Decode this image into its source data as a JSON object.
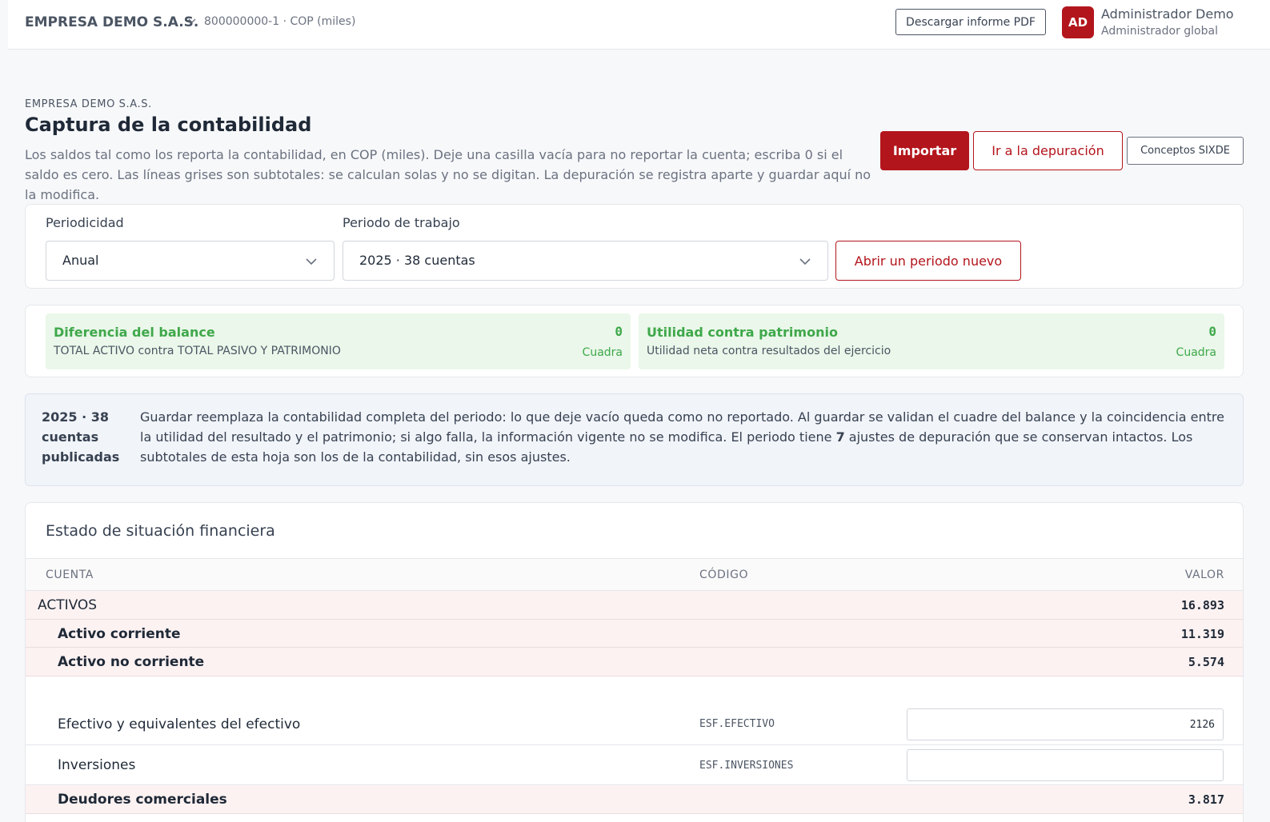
{
  "topbar": {
    "company": "EMPRESA DEMO S.A.S.",
    "nit": "800000000-1 · COP (miles)",
    "pdf_button": "Descargar informe PDF",
    "avatar": "AD",
    "user_name": "Administrador Demo",
    "user_role": "Administrador global"
  },
  "header": {
    "eyebrow": "EMPRESA DEMO S.A.S.",
    "title": "Captura de la contabilidad",
    "description": "Los saldos tal como los reporta la contabilidad, en COP (miles). Deje una casilla vacía para no reportar la cuenta; escriba 0 si el saldo es cero. Las líneas grises son subtotales: se calculan solas y no se digitan. La depuración se registra aparte y guardar aquí no la modifica.",
    "import_button": "Importar",
    "depuracion_button": "Ir a la depuración",
    "sixde_button": "Conceptos SIXDE"
  },
  "period": {
    "periodicity_label": "Periodicidad",
    "periodicity_value": "Anual",
    "work_period_label": "Periodo de trabajo",
    "work_period_value": "2025 · 38 cuentas",
    "open_button": "Abrir un periodo nuevo"
  },
  "checks": [
    {
      "title": "Diferencia del balance",
      "subtitle": "TOTAL ACTIVO contra TOTAL PASIVO Y PATRIMONIO",
      "value": "0",
      "status": "Cuadra"
    },
    {
      "title": "Utilidad contra patrimonio",
      "subtitle": "Utilidad neta contra resultados del ejercicio",
      "value": "0",
      "status": "Cuadra"
    }
  ],
  "info": {
    "tag": "2025 · 38 cuentas publicadas",
    "text_before": "Guardar reemplaza la contabilidad completa del periodo: lo que deje vacío queda como no reportado. Al guardar se validan el cuadre del balance y la coincidencia entre la utilidad del resultado y el patrimonio; si algo falla, la información vigente no se modifica. El periodo tiene ",
    "adjust_count": "7",
    "text_after": " ajustes de depuración que se conservan intactos. Los subtotales de esta hoja son los de la contabilidad, sin esos ajustes."
  },
  "table": {
    "title": "Estado de situación financiera",
    "columns": [
      "CUENTA",
      "CÓDIGO",
      "VALOR"
    ],
    "rows": [
      {
        "label": "ACTIVOS",
        "value": "16.893"
      },
      {
        "label": "Activo corriente",
        "value": "11.319"
      },
      {
        "label": "Activo no corriente",
        "value": "5.574"
      },
      {
        "label": "Efectivo y equivalentes del efectivo",
        "code": "ESF.EFECTIVO",
        "input": "2126"
      },
      {
        "label": "Inversiones",
        "code": "ESF.INVERSIONES",
        "input": ""
      },
      {
        "label": "Deudores comerciales",
        "value": "3.817"
      }
    ]
  }
}
